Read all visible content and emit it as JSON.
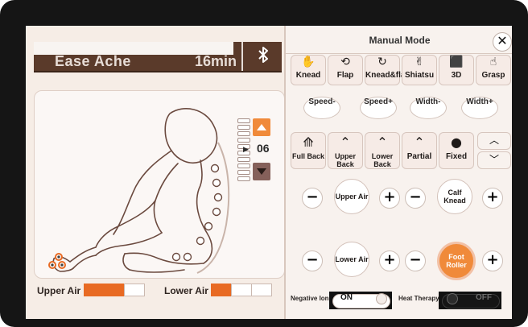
{
  "status": {
    "program_text": "Ease Ache",
    "time_text": "16min",
    "bluetooth_icon": "bluetooth-icon"
  },
  "left_panel": {
    "level_value": "06"
  },
  "air_status": {
    "upper_label": "Upper Air",
    "upper_fraction": 0.67,
    "lower_label": "Lower Air",
    "lower_fraction": 0.33
  },
  "manual": {
    "title": "Manual Mode",
    "modes": [
      {
        "label": "Knead",
        "icon": "knead-icon"
      },
      {
        "label": "Flap",
        "icon": "flap-icon"
      },
      {
        "label": "Knead&flap",
        "icon": "knead-flap-icon"
      },
      {
        "label": "Shiatsu",
        "icon": "shiatsu-icon"
      },
      {
        "label": "3D",
        "icon": "3d-icon"
      },
      {
        "label": "Grasp",
        "icon": "grasp-icon"
      }
    ],
    "speed": [
      "Speed-",
      "Speed+"
    ],
    "width": [
      "Width-",
      "Width+"
    ],
    "parts": [
      {
        "label": "Full Back",
        "icon": "full-back-icon"
      },
      {
        "label": "Upper Back",
        "icon": "chevron-up-icon"
      },
      {
        "label": "Lower Back",
        "icon": "chevron-up-icon"
      },
      {
        "label": "Partial",
        "icon": "chevron-up-icon"
      },
      {
        "label": "Fixed",
        "icon": "dot-icon"
      }
    ],
    "air_controls": [
      {
        "label": "Upper Air"
      },
      {
        "label": "Calf Knead"
      },
      {
        "label": "Lower Air"
      },
      {
        "label": "Foot Roller"
      }
    ],
    "toggles": {
      "negative_ions_label": "Negative Ions",
      "negative_ions_state": "ON",
      "heat_therapy_label": "Heat Therapy",
      "heat_therapy_state": "OFF"
    }
  },
  "colors": {
    "accent": "#f08a3a",
    "brown": "#5a3a2a",
    "bg": "#f6ede6"
  }
}
